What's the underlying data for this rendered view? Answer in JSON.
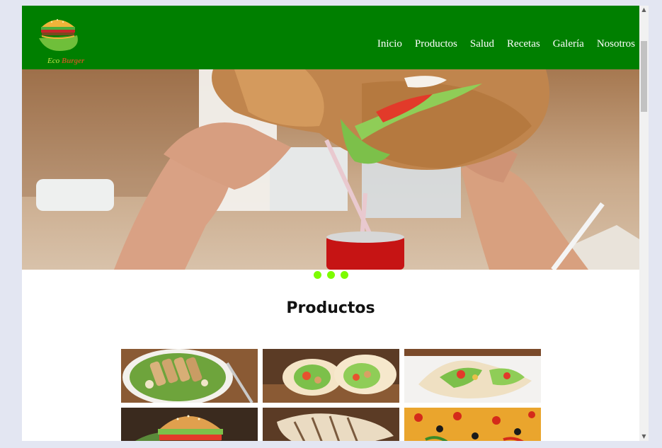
{
  "brand": {
    "logo_word1": "Eco",
    "logo_word2": "Burger"
  },
  "nav": {
    "items": [
      {
        "label": "Inicio"
      },
      {
        "label": "Productos"
      },
      {
        "label": "Salud"
      },
      {
        "label": "Recetas"
      },
      {
        "label": "Galería"
      },
      {
        "label": "Nosotros"
      }
    ]
  },
  "carousel": {
    "slides_count": 3,
    "active_index": 0
  },
  "products": {
    "title": "Productos",
    "items": [
      {
        "image": "chicken-salad"
      },
      {
        "image": "chicken-wraps"
      },
      {
        "image": "veggie-wrap"
      },
      {
        "image": "burger"
      },
      {
        "image": "grilled-pita"
      },
      {
        "image": "pizza"
      }
    ]
  },
  "colors": {
    "header_bg": "#007f00",
    "dot_color": "#7cfc00",
    "page_bg": "#ffffff",
    "frame_bg": "#e3e6f2"
  }
}
